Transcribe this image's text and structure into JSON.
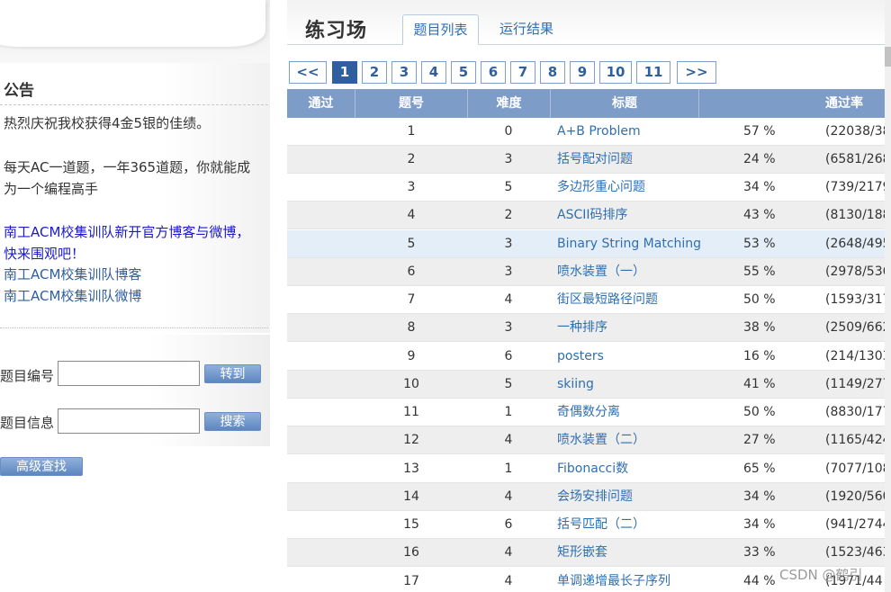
{
  "sidebar": {
    "notice_title": "公告",
    "notice_lines": [
      "热烈庆祝我校获得4金5银的佳绩。",
      "每天AC一道题，一年365道题，你就能成",
      "为一个编程高手",
      "南工ACM校集训队新开官方博客与微博，",
      "快来围观吧！",
      "南工ACM校集训队博客",
      "南工ACM校集训队微博"
    ],
    "search": {
      "id_label": "题目编号",
      "id_value": "",
      "goto_button": "转到",
      "info_label": "题目信息",
      "info_value": "",
      "search_button": "搜索",
      "advanced_button": "高级查找"
    }
  },
  "header": {
    "title": "练习场",
    "tabs": [
      {
        "label": "题目列表",
        "active": true
      },
      {
        "label": "运行结果",
        "active": false
      }
    ]
  },
  "pager": {
    "prev": "<<",
    "pages": [
      "1",
      "2",
      "3",
      "4",
      "5",
      "6",
      "7",
      "8",
      "9",
      "10",
      "11"
    ],
    "current": "1",
    "next": ">>"
  },
  "table": {
    "headers": [
      "通过",
      "题号",
      "难度",
      "标题",
      "通过率"
    ],
    "rows": [
      {
        "id": "1",
        "difficulty": "0",
        "title": "A+B Problem",
        "rate": "57 %",
        "count": "(22038/38"
      },
      {
        "id": "2",
        "difficulty": "3",
        "title": "括号配对问题",
        "rate": "24 %",
        "count": "(6581/268"
      },
      {
        "id": "3",
        "difficulty": "5",
        "title": "多边形重心问题",
        "rate": "34 %",
        "count": "(739/2179"
      },
      {
        "id": "4",
        "difficulty": "2",
        "title": "ASCII码排序",
        "rate": "43 %",
        "count": "(8130/188"
      },
      {
        "id": "5",
        "difficulty": "3",
        "title": "Binary String Matching",
        "rate": "53 %",
        "count": "(2648/495"
      },
      {
        "id": "6",
        "difficulty": "3",
        "title": "喷水装置（一）",
        "rate": "55 %",
        "count": "(2978/536"
      },
      {
        "id": "7",
        "difficulty": "4",
        "title": "街区最短路径问题",
        "rate": "50 %",
        "count": "(1593/317"
      },
      {
        "id": "8",
        "difficulty": "3",
        "title": "一种排序",
        "rate": "38 %",
        "count": "(2509/662"
      },
      {
        "id": "9",
        "difficulty": "6",
        "title": "posters",
        "rate": "16 %",
        "count": "(214/1303"
      },
      {
        "id": "10",
        "difficulty": "5",
        "title": "skiing",
        "rate": "41 %",
        "count": "(1149/277"
      },
      {
        "id": "11",
        "difficulty": "1",
        "title": "奇偶数分离",
        "rate": "50 %",
        "count": "(8830/177"
      },
      {
        "id": "12",
        "difficulty": "4",
        "title": "喷水装置（二）",
        "rate": "27 %",
        "count": "(1165/424"
      },
      {
        "id": "13",
        "difficulty": "1",
        "title": "Fibonacci数",
        "rate": "65 %",
        "count": "(7077/108"
      },
      {
        "id": "14",
        "difficulty": "4",
        "title": "会场安排问题",
        "rate": "34 %",
        "count": "(1920/560"
      },
      {
        "id": "15",
        "difficulty": "6",
        "title": "括号匹配（二）",
        "rate": "34 %",
        "count": "(941/2744"
      },
      {
        "id": "16",
        "difficulty": "4",
        "title": "矩形嵌套",
        "rate": "33 %",
        "count": "(1523/463"
      },
      {
        "id": "17",
        "difficulty": "4",
        "title": "单调递增最长子序列",
        "rate": "44 %",
        "count": "(1971/44"
      }
    ]
  },
  "watermark": "CSDN @鹤引",
  "colors": {
    "accent": "#2f5f9e",
    "table_header": "#7d9cc8",
    "link": "#2f6fb0",
    "highlight_row": "#e4eef8"
  }
}
